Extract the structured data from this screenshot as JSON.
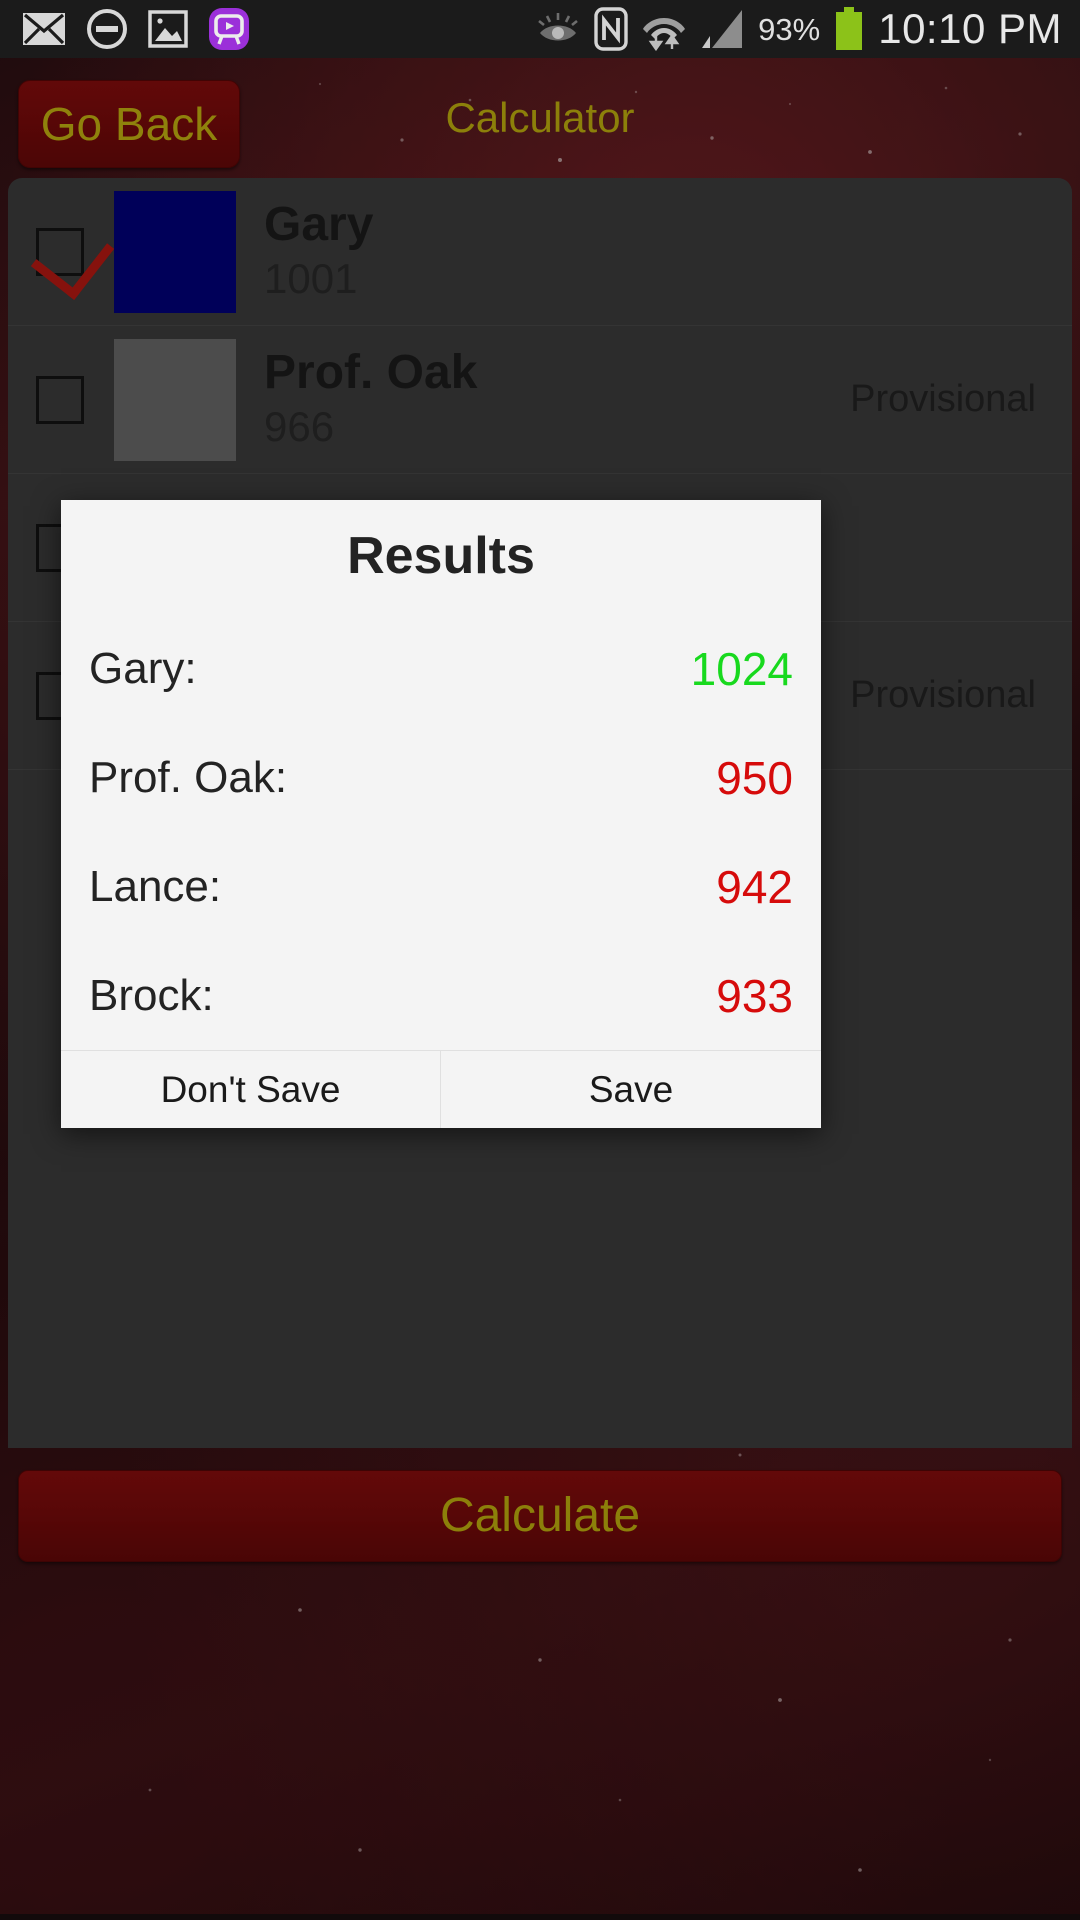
{
  "status_bar": {
    "icons_left": [
      "mail-icon",
      "do-not-disturb-icon",
      "gallery-icon",
      "video-app-icon"
    ],
    "icons_right": [
      "smart-stay-eye-icon",
      "nfc-icon",
      "wifi-data-transfer-icon",
      "signal-bars-icon"
    ],
    "battery_percent": "93%",
    "clock": "10:10 PM",
    "battery_color": "#8cc219"
  },
  "header": {
    "back_label": "Go Back",
    "title": "Calculator",
    "accent_text_color": "#c9b80f",
    "button_color": "#7e0b0b"
  },
  "player_list": [
    {
      "name": "Gary",
      "score": "1001",
      "status": "",
      "swatch": "#000080",
      "checked": true
    },
    {
      "name": "Prof. Oak",
      "score": "966",
      "status": "Provisional",
      "swatch": "#6e6e6e",
      "checked": false
    },
    {
      "name": "",
      "score": "",
      "status": "",
      "swatch": "",
      "checked": false
    },
    {
      "name": "",
      "score": "",
      "status": "Provisional",
      "swatch": "",
      "checked": false
    }
  ],
  "dialog": {
    "title": "Results",
    "rows": [
      {
        "label": "Gary:",
        "value": "1024",
        "color": "#18d91e"
      },
      {
        "label": "Prof. Oak:",
        "value": "950",
        "color": "#d60b0b"
      },
      {
        "label": "Lance:",
        "value": "942",
        "color": "#d60b0b"
      },
      {
        "label": "Brock:",
        "value": "933",
        "color": "#d60b0b"
      }
    ],
    "dont_save_label": "Don't Save",
    "save_label": "Save"
  },
  "footer": {
    "calculate_label": "Calculate"
  }
}
